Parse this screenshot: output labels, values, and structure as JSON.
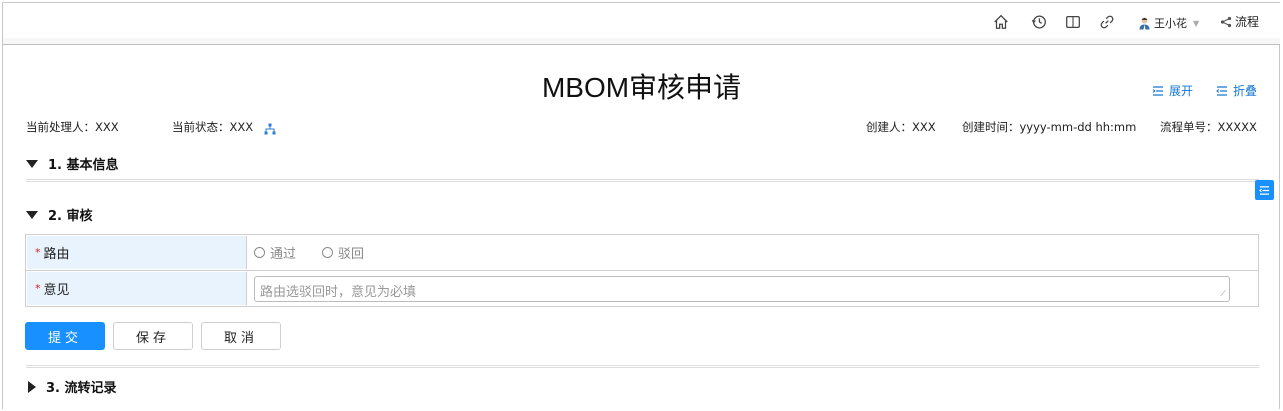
{
  "header": {
    "user_name": "王小花",
    "flow_label": "流程"
  },
  "page": {
    "title": "MBOM审核申请",
    "expand_label": "展开",
    "collapse_label": "折叠"
  },
  "meta": {
    "handler": "当前处理人：XXX",
    "status": "当前状态：XXX",
    "creator": "创建人：XXX",
    "created_time": "创建时间：yyyy-mm-dd hh:mm",
    "flow_no": "流程单号：XXXXX"
  },
  "sections": {
    "basic": "1. 基本信息",
    "review": "2. 审核",
    "records": "3. 流转记录"
  },
  "form": {
    "route_label": "路由",
    "route_options": [
      "通过",
      "驳回"
    ],
    "opinion_label": "意见",
    "opinion_placeholder": "路由选驳回时，意见为必填",
    "required_mark": "*"
  },
  "buttons": {
    "submit": "提交",
    "save": "保存",
    "cancel": "取消"
  },
  "colors": {
    "accent": "#1890ff",
    "link": "#1677d2",
    "label_bg": "#e8f3fd",
    "required": "#e02020"
  }
}
